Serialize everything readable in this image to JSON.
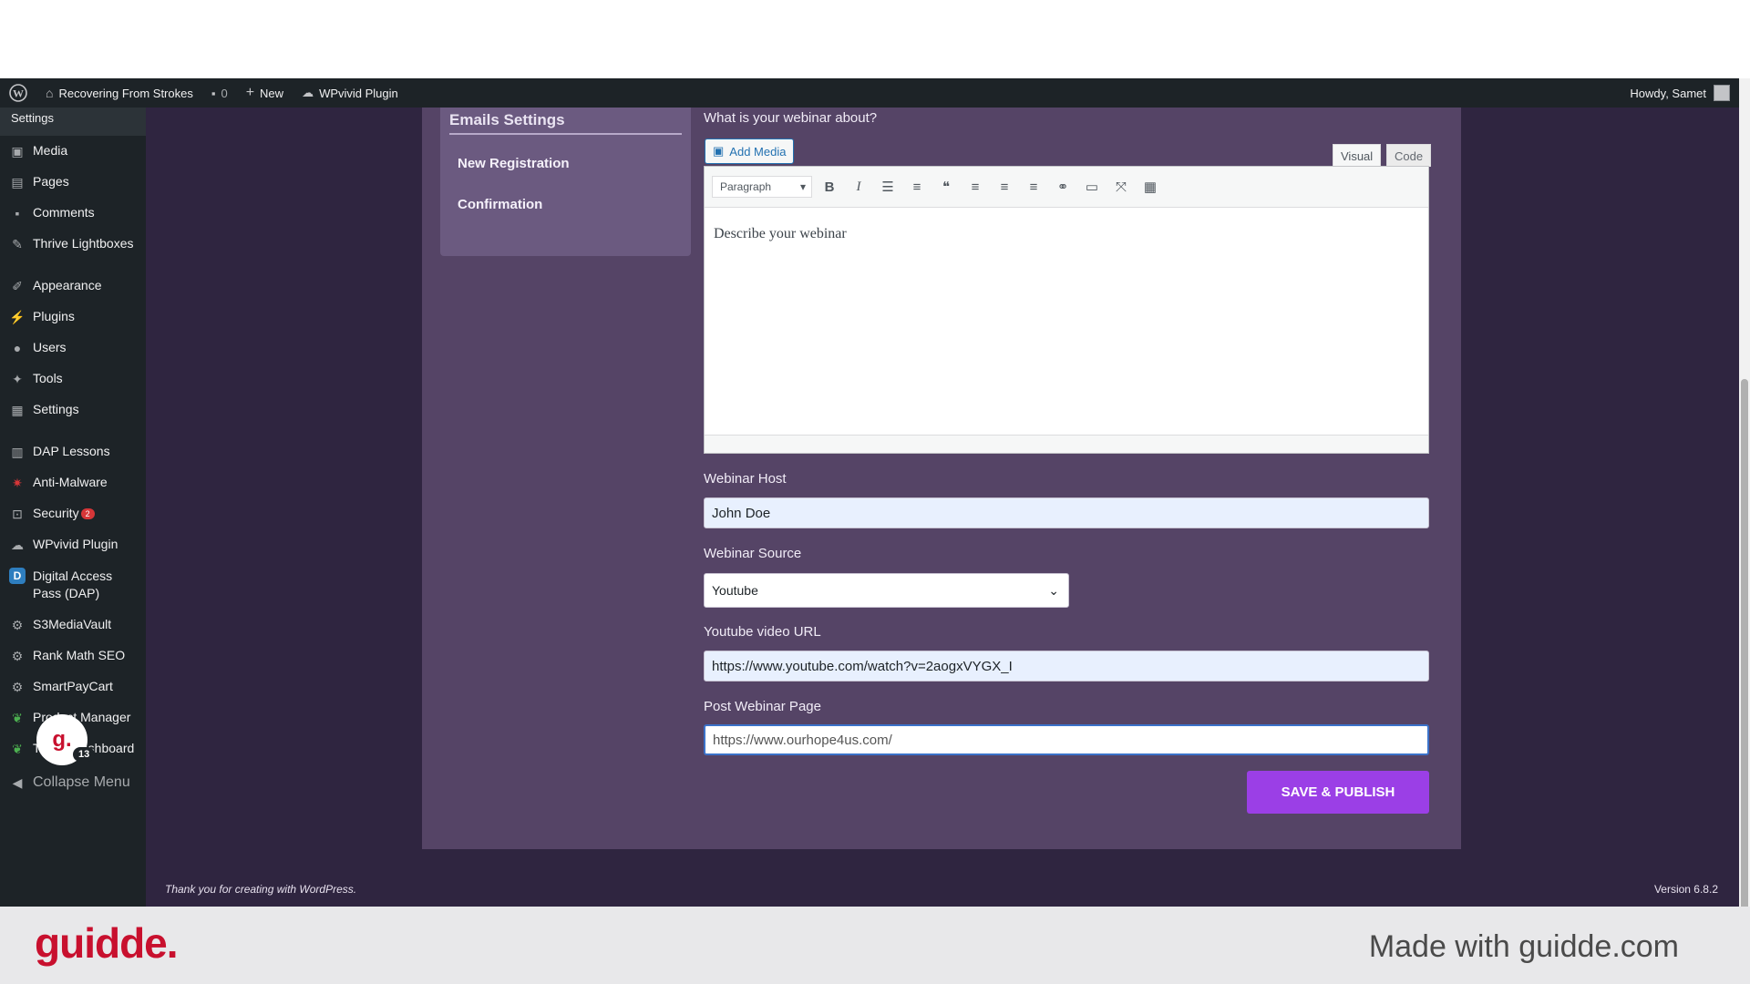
{
  "adminbar": {
    "site_name": "Recovering From Strokes",
    "comments_count": "0",
    "new_label": "New",
    "plugin_label": "WPvivid Plugin",
    "howdy": "Howdy, Samet"
  },
  "sidebar": {
    "submenu_label": "Settings",
    "items": [
      {
        "label": "Media",
        "icon": "media-icon"
      },
      {
        "label": "Pages",
        "icon": "pages-icon"
      },
      {
        "label": "Comments",
        "icon": "comments-icon"
      },
      {
        "label": "Thrive Lightboxes",
        "icon": "pin-icon"
      },
      {
        "label": "Appearance",
        "icon": "brush-icon"
      },
      {
        "label": "Plugins",
        "icon": "plugin-icon"
      },
      {
        "label": "Users",
        "icon": "user-icon"
      },
      {
        "label": "Tools",
        "icon": "wrench-icon"
      },
      {
        "label": "Settings",
        "icon": "settings-icon"
      },
      {
        "label": "DAP Lessons",
        "icon": "book-icon"
      },
      {
        "label": "Anti-Malware",
        "icon": "shield-icon"
      },
      {
        "label": "Security",
        "icon": "lock-icon",
        "badge": "2"
      },
      {
        "label": "WPvivid Plugin",
        "icon": "cloud-icon"
      },
      {
        "label": "Digital Access Pass (DAP)",
        "icon": "dap-icon"
      },
      {
        "label": "S3MediaVault",
        "icon": "gear-icon"
      },
      {
        "label": "Rank Math SEO",
        "icon": "gear-icon"
      },
      {
        "label": "SmartPayCart",
        "icon": "gear-icon"
      },
      {
        "label": "Product Manager",
        "icon": "leaf-icon"
      },
      {
        "label": "Thrive Dashboard",
        "icon": "leaf-icon"
      }
    ],
    "collapse_label": "Collapse Menu",
    "guidde_bubble_letter": "g.",
    "guidde_bubble_count": "13"
  },
  "emails": {
    "title": "Emails Settings",
    "links": [
      "New Registration",
      "Confirmation"
    ]
  },
  "form": {
    "about_label": "What is your webinar about?",
    "add_media_label": "Add Media",
    "tab_visual": "Visual",
    "tab_code": "Code",
    "format_select": "Paragraph",
    "editor_text": "Describe your webinar",
    "host_label": "Webinar Host",
    "host_value": "John Doe",
    "source_label": "Webinar Source",
    "source_value": "Youtube",
    "youtube_label": "Youtube video URL",
    "youtube_value": "https://www.youtube.com/watch?v=2aogxVYGX_I",
    "post_label": "Post Webinar Page",
    "post_value": "https://www.ourhope4us.com/",
    "save_label": "SAVE & PUBLISH"
  },
  "footer": {
    "thanks": "Thank you for creating with WordPress.",
    "version": "Version 6.8.2"
  },
  "guidde": {
    "logo": "guidde.",
    "made_with": "Made with guidde.com"
  },
  "colors": {
    "admin_bg": "#1d2327",
    "panel_bg": "#554466",
    "accent_button": "#9b3fe6",
    "guidde_red": "#c8102e"
  }
}
